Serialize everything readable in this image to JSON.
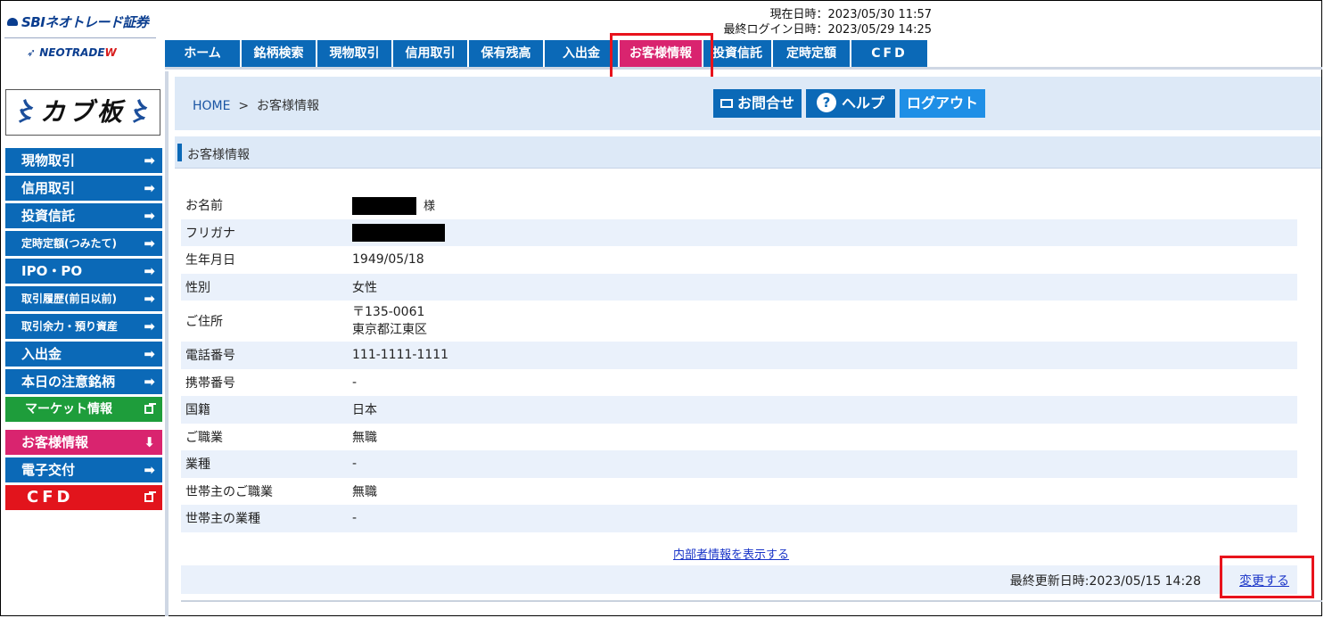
{
  "header": {
    "brand_top": "SBIネオトレード証券",
    "brand_bottom_main": "NEOTRADE",
    "brand_bottom_accent": "W",
    "current_time_label": "現在日時：",
    "current_time": "2023/05/30 11:57",
    "last_login_label": "最終ログイン日時：",
    "last_login": "2023/05/29 14:25"
  },
  "global_nav": [
    {
      "label": "ホーム"
    },
    {
      "label": "銘柄検索"
    },
    {
      "label": "現物取引"
    },
    {
      "label": "信用取引"
    },
    {
      "label": "保有残高"
    },
    {
      "label": "入出金"
    },
    {
      "label": "お客様情報"
    },
    {
      "label": "投資信託"
    },
    {
      "label": "定時定額"
    },
    {
      "label": "CFD"
    }
  ],
  "sidebar": {
    "kabu_logo": "カブ板",
    "items": [
      {
        "label": "現物取引",
        "icon": "arrow-right-icon"
      },
      {
        "label": "信用取引",
        "icon": "arrow-right-icon"
      },
      {
        "label": "投資信託",
        "icon": "arrow-right-icon"
      },
      {
        "label": "定時定額(つみたて)",
        "icon": "arrow-right-icon"
      },
      {
        "label": "IPO・PO",
        "icon": "arrow-right-icon"
      },
      {
        "label": "取引履歴(前日以前)",
        "icon": "arrow-right-icon"
      },
      {
        "label": "取引余力・預り資産",
        "icon": "arrow-right-icon"
      },
      {
        "label": "入出金",
        "icon": "arrow-right-icon"
      },
      {
        "label": "本日の注意銘柄",
        "icon": "arrow-right-icon"
      },
      {
        "label": "マーケット情報",
        "icon": "external-window-icon"
      },
      {
        "label": "お客様情報",
        "icon": "arrow-down-icon"
      },
      {
        "label": "電子交付",
        "icon": "arrow-right-icon"
      },
      {
        "label": "CFD",
        "icon": "external-window-icon"
      }
    ]
  },
  "breadcrumb": {
    "home": "HOME",
    "separator": ">",
    "current": "お客様情報"
  },
  "toolbar": {
    "contact": "お問合せ",
    "help": "ヘルプ",
    "help_icon": "?",
    "logout": "ログアウト"
  },
  "section_title": "お客様情報",
  "customer": {
    "name_label": "お名前",
    "name_suffix": "様",
    "furigana_label": "フリガナ",
    "birth_label": "生年月日",
    "birth": "1949/05/18",
    "gender_label": "性別",
    "gender": "女性",
    "address_label": "ご住所",
    "postal": "〒135-0061",
    "address": "東京都江東区",
    "phone_label": "電話番号",
    "phone": "111-1111-1111",
    "mobile_label": "携帯番号",
    "mobile": "-",
    "nationality_label": "国籍",
    "nationality": "日本",
    "occupation_label": "ご職業",
    "occupation": "無職",
    "industry_label": "業種",
    "industry": "-",
    "head_occupation_label": "世帯主のご職業",
    "head_occupation": "無職",
    "head_industry_label": "世帯主の業種",
    "head_industry": "-"
  },
  "insider_link": "内部者情報を表示する",
  "footer": {
    "updated_label": "最終更新日時:",
    "updated": "2023/05/15 14:28",
    "change": "変更する"
  },
  "colors": {
    "nav_blue": "#0b69b7",
    "active_pink": "#d9246f",
    "highlight_red": "#e8131c",
    "market_green": "#1e9d3b"
  }
}
